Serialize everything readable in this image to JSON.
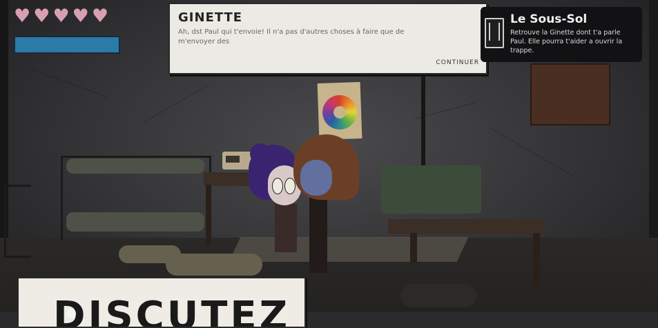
{
  "hud": {
    "hearts_full": 5,
    "heart_icon": "heart-icon",
    "heart_color": "#d7a0b0",
    "energy_color": "#2b7aa8"
  },
  "dialogue": {
    "speaker": "GINETTE",
    "text": "Ah, dst Paul qui t'envoie! Il n'a pas d'autres choses à faire que de m'envoyer des",
    "continue_label": "CONTINUER"
  },
  "quest": {
    "icon": "document-icon",
    "title": "Le Sous-Sol",
    "description": "Retrouve la Ginette dont t'a parle Paul. Elle pourra t'aider a ouvrir la trappe."
  },
  "action": {
    "label": "DISCUTEZ"
  }
}
